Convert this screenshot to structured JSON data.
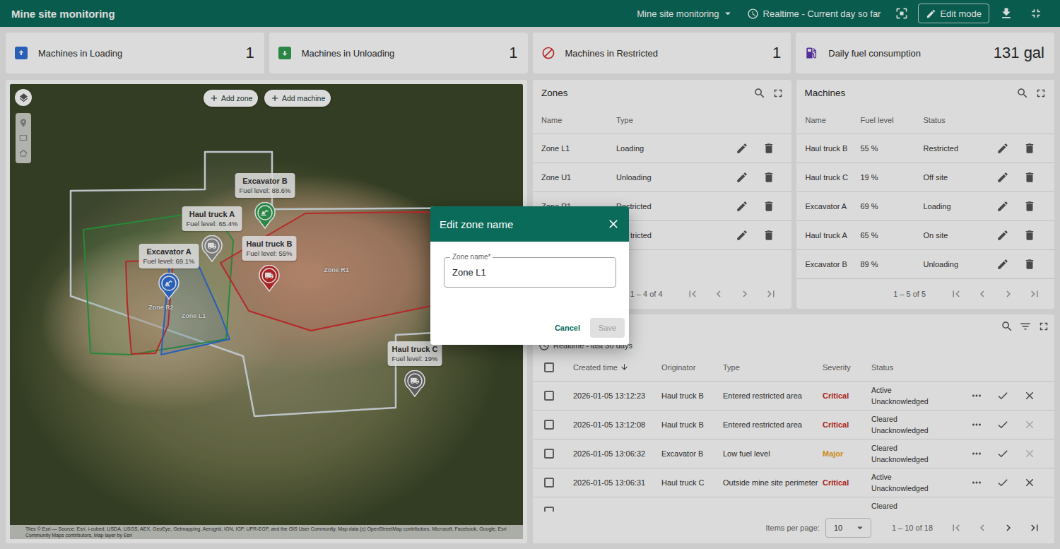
{
  "app_bar": {
    "title": "Mine site monitoring",
    "dashboard": "Mine site monitoring",
    "timewindow": "Realtime - Current day so far",
    "edit_mode": "Edit mode"
  },
  "stats": [
    {
      "label": "Machines in Loading",
      "value": "1",
      "kind": "loading",
      "color": "#2f6fd6"
    },
    {
      "label": "Machines in Unloading",
      "value": "1",
      "kind": "unloading",
      "color": "#2e9e4f"
    },
    {
      "label": "Machines in Restricted",
      "value": "1",
      "kind": "restricted",
      "color": "#d32f2f"
    },
    {
      "label": "Daily fuel consumption",
      "value": "131 gal",
      "kind": "fuel",
      "color": "#5e35b1"
    }
  ],
  "map": {
    "add_zone": "Add zone",
    "add_machine": "Add machine",
    "zones": [
      {
        "kind": "perimeter",
        "color": "#dde5ea"
      },
      {
        "kind": "unloading",
        "color": "#2ea043"
      },
      {
        "kind": "restricted",
        "label": "Zone R2",
        "color": "#d32f2f"
      },
      {
        "kind": "loading",
        "label": "Zone L1",
        "color": "#2f6fd6"
      },
      {
        "kind": "restricted",
        "label": "Zone R1",
        "color": "#d32f2f"
      }
    ],
    "machines": [
      {
        "name": "Excavator B",
        "fuel": "Fuel level: 88.6%",
        "kind": "excavator",
        "color": "#2e9e4f"
      },
      {
        "name": "Haul truck A",
        "fuel": "Fuel level: 65.4%",
        "kind": "truck",
        "color": "#8e8e8e"
      },
      {
        "name": "Excavator A",
        "fuel": "Fuel level: 69.1%",
        "kind": "excavator",
        "color": "#2f6fd6"
      },
      {
        "name": "Haul truck B",
        "fuel": "Fuel level: 55%",
        "kind": "truck",
        "color": "#c62828"
      },
      {
        "name": "Haul truck C",
        "fuel": "Fuel level: 19%",
        "kind": "truck",
        "color": "#6d6d6d"
      }
    ],
    "attribution": "Tiles © Esri — Source: Esri, i-cubed, USDA, USGS, AEX, GeoEye, Getmapping, Aerogrid, IGN, IGP, UPR-EGP, and the GIS User Community, Map data (c) OpenStreetMap contributors, Microsoft, Facebook, Google, Esri Community Maps contributors, Map layer by Esri"
  },
  "zones_panel": {
    "title": "Zones",
    "columns": [
      "Name",
      "Type"
    ],
    "rows": [
      {
        "kind": "plain",
        "name": "Zone L1",
        "type": "Loading"
      },
      {
        "kind": "plain",
        "name": "Zone U1",
        "type": "Unloading"
      },
      {
        "kind": "plain",
        "name": "Zone R1",
        "type": "Restricted"
      },
      {
        "kind": "covered",
        "type": "tricted"
      }
    ],
    "range": "1 – 4 of 4"
  },
  "machines_panel": {
    "title": "Machines",
    "columns": [
      "Name",
      "Fuel level",
      "Status"
    ],
    "rows": [
      [
        "Haul truck B",
        "55 %",
        "Restricted"
      ],
      [
        "Haul truck C",
        "19 %",
        "Off site"
      ],
      [
        "Excavator A",
        "69 %",
        "Loading"
      ],
      [
        "Haul truck A",
        "65 %",
        "On site"
      ],
      [
        "Excavator B",
        "89 %",
        "Unloading"
      ]
    ],
    "range": "1 – 5 of 5"
  },
  "alarms_panel": {
    "subtitle": "Realtime - last 30 days",
    "columns": [
      "Created time",
      "Originator",
      "Type",
      "Severity",
      "Status"
    ],
    "rows": [
      {
        "checked": false,
        "time": "2026-01-05 13:12:23",
        "originator": "Haul truck B",
        "type": "Entered restricted area",
        "severity": "Critical",
        "color": "#c62828",
        "status": [
          "Active",
          "Unacknowledged"
        ],
        "clear_disabled": false
      },
      {
        "checked": false,
        "time": "2026-01-05 13:12:08",
        "originator": "Haul truck B",
        "type": "Entered restricted area",
        "severity": "Critical",
        "color": "#c62828",
        "status": [
          "Cleared",
          "Unacknowledged"
        ],
        "clear_disabled": true
      },
      {
        "checked": false,
        "time": "2026-01-05 13:06:32",
        "originator": "Excavator B",
        "type": "Low fuel level",
        "severity": "Major",
        "color": "#eea020",
        "status": [
          "Cleared",
          "Unacknowledged"
        ],
        "clear_disabled": true
      },
      {
        "checked": false,
        "time": "2026-01-05 13:06:31",
        "originator": "Haul truck C",
        "type": "Outside mine site perimeter",
        "severity": "Critical",
        "color": "#c62828",
        "status": [
          "Active",
          "Unacknowledged"
        ],
        "clear_disabled": false
      },
      {
        "checked": false,
        "status": [
          "Cleared"
        ]
      }
    ],
    "items_per_page_label": "Items per page:",
    "items_per_page": "10",
    "range": "1 – 10 of 18"
  },
  "dialog": {
    "title": "Edit zone name",
    "field_label": "Zone name*",
    "field_value": "Zone L1",
    "cancel": "Cancel",
    "save": "Save",
    "save_disabled": true
  }
}
